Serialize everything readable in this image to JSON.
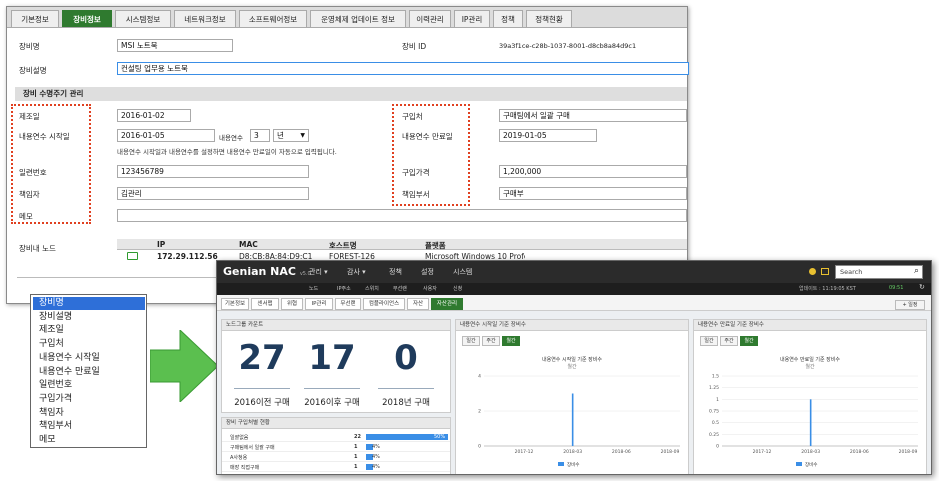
{
  "tabs": [
    "기본정보",
    "장비정보",
    "시스템정보",
    "네트워크정보",
    "소프트웨어정보",
    "운영체제 업데이트 정보",
    "이력관리",
    "IP관리",
    "정책",
    "정책현황"
  ],
  "active_tab": "장비정보",
  "form": {
    "device_name_label": "장비명",
    "device_name_value": "MSI 노트북",
    "device_desc_label": "장비설명",
    "device_desc_value": "컨설팅 업무용 노트북",
    "device_id_label": "장비 ID",
    "device_id_value": "39a3f1ce-c28b-1037-8001-d8cb8a84d9c1",
    "section_title": "장비 수명주기 관리",
    "manufacture_label": "제조일",
    "manufacture_value": "2016-01-02",
    "life_start_label": "내용연수 시작일",
    "life_start_value": "2016-01-05",
    "life_years_label": "내용연수",
    "life_years_value": "3",
    "life_unit_value": "년",
    "hint": "내용연수 시작일과 내용연수를 설정하면 내용연수 만료일이 자동으로 입력됩니다.",
    "serial_label": "일련번호",
    "serial_value": "123456789",
    "owner_label": "책임자",
    "owner_value": "김관리",
    "memo_label": "메모",
    "purchase_from_label": "구입처",
    "purchase_from_value": "구매팀에서 일괄 구매",
    "life_end_label": "내용연수 만료일",
    "life_end_value": "2019-01-05",
    "price_label": "구입가격",
    "price_value": "1,200,000",
    "dept_label": "책임부서",
    "dept_value": "구매부"
  },
  "nodes": {
    "label": "장비내 노드",
    "headers": [
      "IP",
      "MAC",
      "호스트명",
      "플랫폼"
    ],
    "row": [
      "172.29.112.56",
      "D8:CB:8A:84:D9:C1",
      "FOREST-126",
      "Microsoft Windows 10 Professional x64"
    ]
  },
  "dropdown": {
    "items": [
      "장비명",
      "장비설명",
      "제조일",
      "구입처",
      "내용연수 시작일",
      "내용연수 만료일",
      "일련번호",
      "구입가격",
      "책임자",
      "책임부서",
      "메모"
    ],
    "selected": 0
  },
  "nac": {
    "brand": "Genian NAC",
    "version": "v5.0",
    "menu": [
      "관리 ▾",
      "감사 ▾",
      "정책",
      "설정",
      "시스템"
    ],
    "submenu": [
      "노드",
      "IP주소",
      "스위치",
      "무선랜",
      "사용자",
      "신청"
    ],
    "search_placeholder": "Search",
    "status": "업데이트 : 11:19:05 KST",
    "status2": "09:51",
    "tabs": [
      "기본정보",
      "센서맵",
      "위협",
      "IP관리",
      "무선랜",
      "컴플라이언스",
      "자산",
      "자산관리"
    ],
    "add_button": "+ 일정",
    "count_panel": {
      "title": "노드그룹 카운트",
      "counts": [
        {
          "value": "27",
          "label": "2016이전 구매"
        },
        {
          "value": "17",
          "label": "2016이후 구매"
        },
        {
          "value": "0",
          "label": "2018년 구매"
        }
      ]
    },
    "table_panel": {
      "title": "장비 구입처별 현황",
      "rows": [
        {
          "name": "일괄없음",
          "count": "22",
          "pct": "50%"
        },
        {
          "name": "구매팀에서 일괄 구매",
          "count": "1",
          "pct": "4%"
        },
        {
          "name": "A사청용",
          "count": "1",
          "pct": "4%"
        },
        {
          "name": "매장 직접구매",
          "count": "1",
          "pct": "4%"
        }
      ]
    },
    "chart_panels": [
      {
        "title": "내용연수 시작일 기준 장비수",
        "ctitle": "내용연수 시작일 기준 장비수",
        "csub": "월간",
        "legend": "장비수"
      },
      {
        "title": "내용연수 만료일 기준 장비수",
        "ctitle": "내용연수 만료일 기준 장비수",
        "csub": "월간",
        "legend": "장비수"
      }
    ],
    "range_buttons": [
      "일간",
      "주간",
      "월간"
    ],
    "range_active": 2
  },
  "chart_data": [
    {
      "type": "bar",
      "title": "내용연수 시작일 기준 장비수",
      "subtitle": "월간",
      "x": [
        "2017-12",
        "2018-03",
        "2018-06",
        "2018-09"
      ],
      "values": [
        0,
        3,
        0,
        0
      ],
      "ylim": [
        0,
        4
      ],
      "yticks": [
        "0",
        "2",
        "4"
      ],
      "series": [
        {
          "name": "장비수",
          "color": "#3a8ee6"
        }
      ]
    },
    {
      "type": "bar",
      "title": "내용연수 만료일 기준 장비수",
      "subtitle": "월간",
      "x": [
        "2017-12",
        "2018-03",
        "2018-06",
        "2018-09"
      ],
      "values": [
        0,
        1,
        0,
        0
      ],
      "ylim": [
        0,
        1.5
      ],
      "yticks": [
        "0",
        "0.25",
        "0.5",
        "0.75",
        "1",
        "1.25",
        "1.5"
      ],
      "series": [
        {
          "name": "장비수",
          "color": "#3a8ee6"
        }
      ]
    }
  ],
  "colors": {
    "accent": "#2f7a2f",
    "highlight": "#e04020",
    "selection": "#2e6fd8",
    "arrow": "#5bbf4f",
    "bar": "#3a8ee6"
  }
}
